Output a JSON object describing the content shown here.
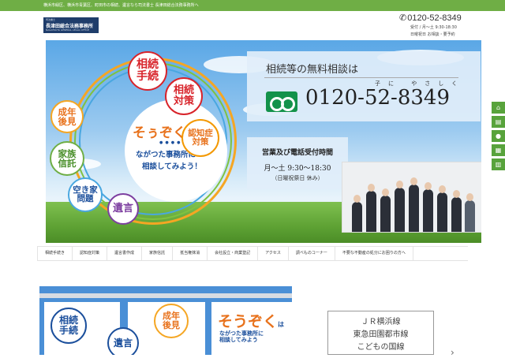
{
  "topbar": {
    "text": "横浜市緑区、横浜市青葉区、町田市の相続、遺言なら司法書士 長津田総合法務事務所へ"
  },
  "logo": {
    "small": "司法書士",
    "name": "長津田総合法務事務所",
    "en": "NAGATSUTA GENERAL LEGAL OFFICE"
  },
  "header": {
    "phone": "0120-52-8349",
    "phone_icon": "phone-icon",
    "hours": "受付 / 月～土 9:30-18:30",
    "holiday": "日曜祝日 お相談・要予約"
  },
  "hero": {
    "bubbles": {
      "souzoku_tetsuzuki": "相続\n手続",
      "souzoku_taisaku": "相続\n対策",
      "ninchisho": "認知症\n対策",
      "seinen": "成年\n後見",
      "kazoku": "家族\n信託",
      "akiya": "空き家\n問題",
      "yuigon": "遺言"
    },
    "center_big": "そぅぞくは",
    "center_dots": "●●●●",
    "center_line2": "ながつた事務所に",
    "center_line3": "相談してみよう！",
    "consult_title": "相続等の無料相談は",
    "consult_ruby": "子に やさしく",
    "consult_number": "0120-52-8349",
    "hours_title": "営業及び電話受付時間",
    "hours_time": "月～土 9:30～18:30",
    "hours_note": "（日曜祝祭日 休み）"
  },
  "nav": {
    "items": [
      "相続手続き",
      "認知症対策",
      "遺言書作成",
      "家族信託",
      "抵当権抹消",
      "会社設立・商業登記",
      "アクセス",
      "調べものコーナー",
      "不要な不動産の処分にお困りの方へ"
    ]
  },
  "side": {
    "icons": [
      "home-icon",
      "document-icon",
      "map-pin-icon",
      "calendar-icon",
      "book-icon"
    ]
  },
  "banner": {
    "b1": "相続\n手続",
    "b2": "遺言",
    "b3": "成年\n後見",
    "b4": "そうぞく",
    "b4_suffix": "は",
    "b5": "ながつた事務所に\n相談してみよう"
  },
  "sign": {
    "line1": "ＪＲ横浜線",
    "line2": "東急田園都市線",
    "line3": "こどもの国線"
  },
  "colors": {
    "brand_green": "#6fae45",
    "navy": "#1f3d6b",
    "orange": "#e8721c",
    "blue": "#1b4f9c",
    "red": "#d8232a"
  }
}
